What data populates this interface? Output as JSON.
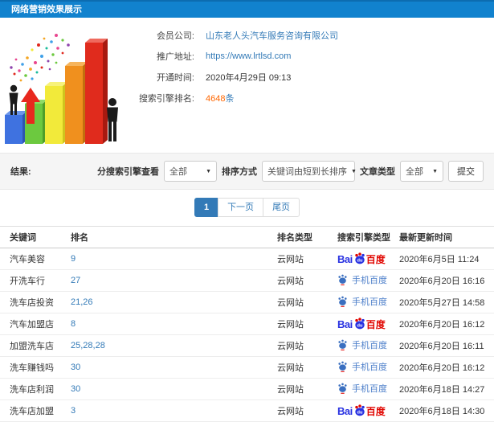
{
  "header": {
    "title": "网络营销效果展示"
  },
  "info": {
    "rows": [
      {
        "label": "会员公司:",
        "value": "山东老人头汽车服务咨询有限公司"
      },
      {
        "label": "推广地址:",
        "value": "https://www.lrtlsd.com"
      },
      {
        "label": "开通时间:",
        "value": "2020年4月29日 09:13"
      },
      {
        "label": "搜索引擎排名:",
        "value": "4648",
        "suffix": "条"
      }
    ]
  },
  "filters": {
    "result_label": "结果:",
    "engine_view_label": "分搜索引擎查看",
    "engine_view_value": "全部",
    "sort_label": "排序方式",
    "sort_value": "关键词由短到长排序",
    "article_label": "文章类型",
    "article_value": "全部",
    "submit_label": "提交"
  },
  "pagination": {
    "current": "1",
    "next_label": "下一页",
    "last_label": "尾页"
  },
  "table": {
    "headers": [
      "关键词",
      "排名",
      "排名类型",
      "搜索引擎类型",
      "最新更新时间"
    ],
    "rows": [
      {
        "keyword": "汽车美容",
        "rank": "9",
        "rank_type": "云网站",
        "engine": "baidu",
        "updated": "2020年6月5日 11:24"
      },
      {
        "keyword": "开洗车行",
        "rank": "27",
        "rank_type": "云网站",
        "engine": "mobile-baidu",
        "updated": "2020年6月20日 16:16"
      },
      {
        "keyword": "洗车店投资",
        "rank": "21,26",
        "rank_type": "云网站",
        "engine": "mobile-baidu",
        "updated": "2020年5月27日 14:58"
      },
      {
        "keyword": "汽车加盟店",
        "rank": "8",
        "rank_type": "云网站",
        "engine": "baidu",
        "updated": "2020年6月20日 16:12"
      },
      {
        "keyword": "加盟洗车店",
        "rank": "25,28,28",
        "rank_type": "云网站",
        "engine": "mobile-baidu",
        "updated": "2020年6月20日 16:11"
      },
      {
        "keyword": "洗车赚钱吗",
        "rank": "30",
        "rank_type": "云网站",
        "engine": "mobile-baidu",
        "updated": "2020年6月20日 16:12"
      },
      {
        "keyword": "洗车店利润",
        "rank": "30",
        "rank_type": "云网站",
        "engine": "mobile-baidu",
        "updated": "2020年6月18日 14:27"
      },
      {
        "keyword": "洗车店加盟",
        "rank": "3",
        "rank_type": "云网站",
        "engine": "baidu",
        "updated": "2020年6月18日 14:30"
      }
    ]
  },
  "logos": {
    "baidu": {
      "bai": "Bai",
      "du": "du",
      "cn": "百度"
    },
    "mobile_baidu": {
      "label": "手机百度"
    }
  },
  "colors": {
    "header_bg": "#1182ce",
    "link_blue": "#337ab7",
    "accent_orange": "#ff6600",
    "baidu_blue": "#2932e1",
    "baidu_red": "#e10601",
    "mobile_blue": "#4a7dc9",
    "filter_bg": "#f5f5f5"
  }
}
